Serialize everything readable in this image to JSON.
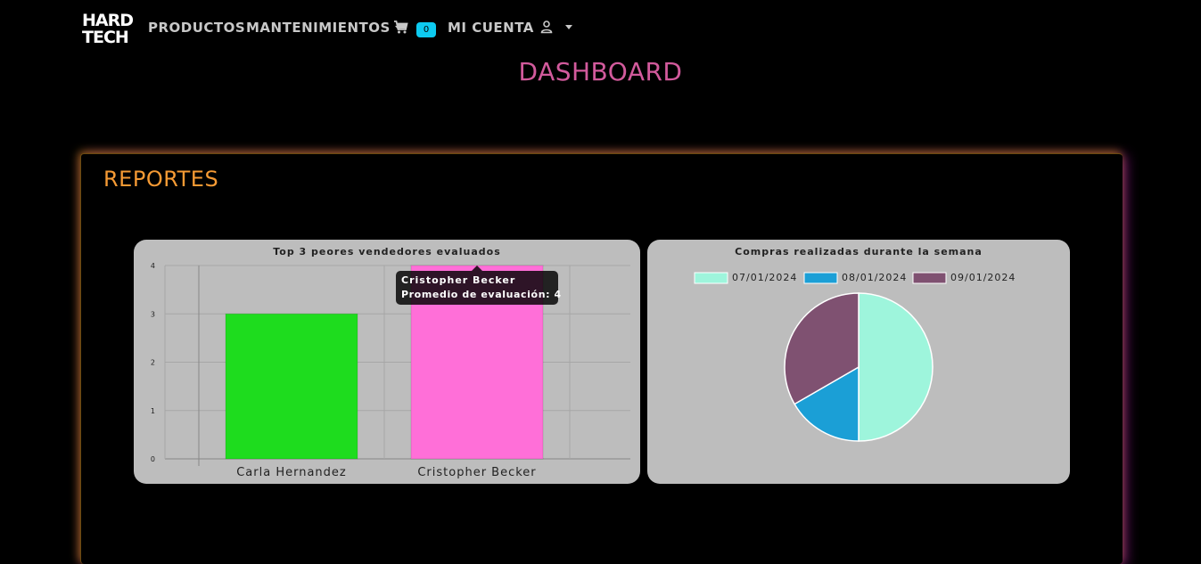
{
  "nav": {
    "logo_line1": "HARD",
    "logo_line2": "TECH",
    "productos": "PRODUCTOS",
    "mantenimientos": "MANTENIMIENTOS",
    "cart_count": "0",
    "mi_cuenta": "MI CUENTA"
  },
  "page": {
    "title": "DASHBOARD",
    "section_title": "REPORTES"
  },
  "colors": {
    "title_pink": "#d25a9c",
    "section_orange": "#f59a34",
    "badge_cyan": "#0dcaf0",
    "card_bg": "#bdbdbd"
  },
  "chart_data": [
    {
      "type": "bar",
      "title": "Top 3 peores vendedores evaluados",
      "categories": [
        "Carla Hernandez",
        "Cristopher Becker"
      ],
      "values": [
        3,
        4
      ],
      "colors": [
        "#1edc1e",
        "#ff6fd8"
      ],
      "ylim": [
        0,
        4
      ],
      "yticks": [
        "0",
        "1",
        "2",
        "3",
        "4"
      ],
      "grid": true,
      "tooltip": {
        "title": "Cristopher Becker",
        "body": "Promedio de evaluación: 4"
      }
    },
    {
      "type": "pie",
      "title": "Compras realizadas durante la semana",
      "legend_position": "top",
      "labels": [
        "07/01/2024",
        "08/01/2024",
        "09/01/2024"
      ],
      "values": [
        3,
        1,
        2
      ],
      "colors": [
        "#9ef5dc",
        "#1b9fd6",
        "#7f5171"
      ]
    }
  ]
}
